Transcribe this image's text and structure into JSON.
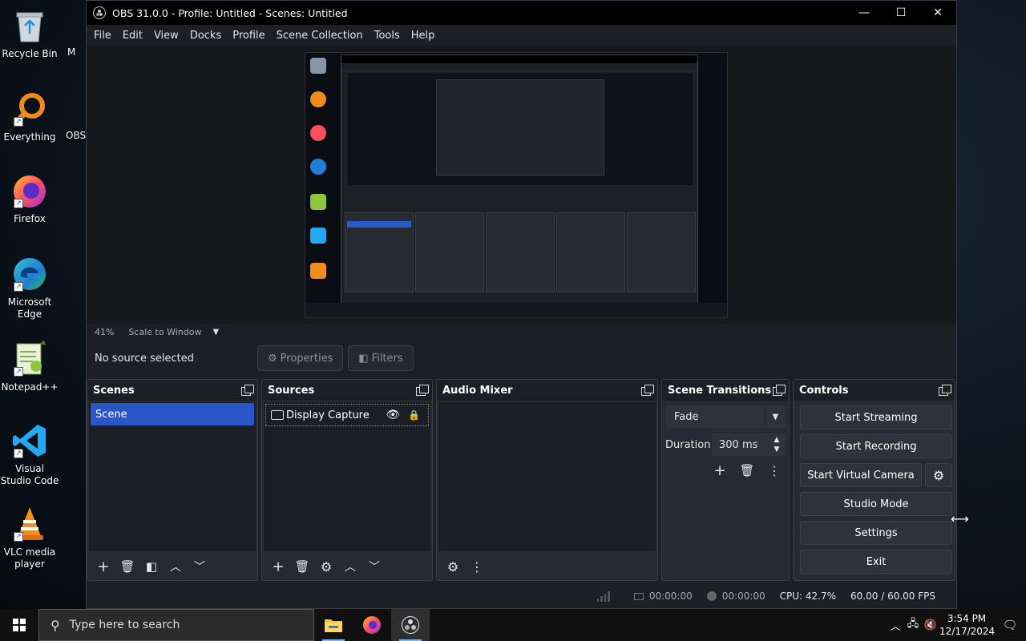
{
  "desktop": {
    "icons": [
      {
        "label": "Recycle Bin",
        "icon": "recycle-bin-icon"
      },
      {
        "label": "Everything",
        "icon": "everything-search-icon"
      },
      {
        "label": "Firefox",
        "icon": "firefox-icon"
      },
      {
        "label": "Microsoft Edge",
        "icon": "edge-icon"
      },
      {
        "label": "Notepad++",
        "icon": "notepad-plus-plus-icon"
      },
      {
        "label": "Visual Studio Code",
        "icon": "vscode-icon"
      },
      {
        "label": "VLC media player",
        "icon": "vlc-icon"
      }
    ],
    "partial_labels": [
      "M",
      "OBS"
    ]
  },
  "window": {
    "title": "OBS 31.0.0 - Profile: Untitled - Scenes: Untitled",
    "controls": {
      "minimize": "—",
      "maximize": "☐",
      "close": "✕"
    }
  },
  "menu": [
    "File",
    "Edit",
    "View",
    "Docks",
    "Profile",
    "Scene Collection",
    "Tools",
    "Help"
  ],
  "preview": {
    "zoom": "41%",
    "scale_mode": "Scale to Window"
  },
  "source_toolbar": {
    "status": "No source selected",
    "properties_label": "Properties",
    "filters_label": "Filters"
  },
  "docks": {
    "scenes": {
      "title": "Scenes",
      "items": [
        "Scene"
      ]
    },
    "sources": {
      "title": "Sources",
      "items": [
        {
          "name": "Display Capture",
          "visible": true,
          "locked": false
        }
      ]
    },
    "audio_mixer": {
      "title": "Audio Mixer"
    },
    "scene_transitions": {
      "title": "Scene Transitions",
      "transition": "Fade",
      "duration_label": "Duration",
      "duration_value": "300 ms"
    },
    "controls": {
      "title": "Controls",
      "buttons": {
        "start_streaming": "Start Streaming",
        "start_recording": "Start Recording",
        "start_virtual_camera": "Start Virtual Camera",
        "studio_mode": "Studio Mode",
        "settings": "Settings",
        "exit": "Exit"
      }
    }
  },
  "status_bar": {
    "stream_time": "00:00:00",
    "record_time": "00:00:00",
    "cpu": "CPU: 42.7%",
    "fps": "60.00 / 60.00 FPS"
  },
  "taskbar": {
    "search_placeholder": "Type here to search",
    "apps": [
      "file-explorer-icon",
      "firefox-icon",
      "obs-icon"
    ],
    "time": "3:54 PM",
    "date": "12/17/2024"
  },
  "colors": {
    "accent_blue": "#2b56c7",
    "panel_bg": "#272a33",
    "window_bg": "#1d1f26"
  }
}
